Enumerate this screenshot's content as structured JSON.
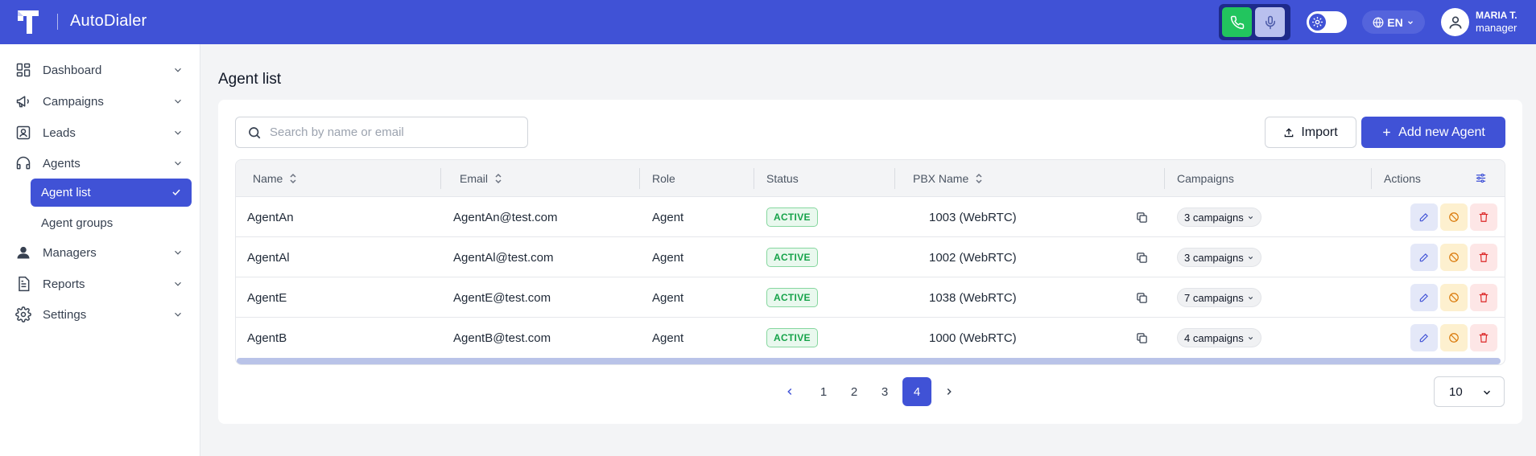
{
  "app": {
    "title": "AutoDialer"
  },
  "header": {
    "lang": "EN",
    "user_name": "MARIA T.",
    "user_role": "manager"
  },
  "sidebar": {
    "items": [
      {
        "label": "Dashboard",
        "icon": "dashboard-icon"
      },
      {
        "label": "Campaigns",
        "icon": "megaphone-icon"
      },
      {
        "label": "Leads",
        "icon": "id-card-icon"
      },
      {
        "label": "Agents",
        "icon": "headset-icon"
      },
      {
        "label": "Managers",
        "icon": "user-icon"
      },
      {
        "label": "Reports",
        "icon": "report-icon"
      },
      {
        "label": "Settings",
        "icon": "gear-icon"
      }
    ],
    "sub_items": [
      {
        "label": "Agent list",
        "active": true
      },
      {
        "label": "Agent groups",
        "active": false
      }
    ]
  },
  "main": {
    "title": "Agent list",
    "search_placeholder": "Search by name or email",
    "import_label": "Import",
    "add_label": "Add new Agent",
    "columns": [
      "Name",
      "Email",
      "Role",
      "Status",
      "PBX Name",
      "Campaigns",
      "Actions"
    ],
    "rows": [
      {
        "name": "AgentAn",
        "email": "AgentAn@test.com",
        "role": "Agent",
        "status": "ACTIVE",
        "pbx": "1003 (WebRTC)",
        "campaigns": "3 campaigns"
      },
      {
        "name": "AgentAl",
        "email": "AgentAl@test.com",
        "role": "Agent",
        "status": "ACTIVE",
        "pbx": "1002 (WebRTC)",
        "campaigns": "3 campaigns"
      },
      {
        "name": "AgentE",
        "email": "AgentE@test.com",
        "role": "Agent",
        "status": "ACTIVE",
        "pbx": "1038 (WebRTC)",
        "campaigns": "7 campaigns"
      },
      {
        "name": "AgentB",
        "email": "AgentB@test.com",
        "role": "Agent",
        "status": "ACTIVE",
        "pbx": "1000 (WebRTC)",
        "campaigns": "4 campaigns"
      }
    ],
    "pagination": {
      "pages": [
        "1",
        "2",
        "3",
        "4"
      ],
      "current": "4",
      "per_page": "10"
    }
  },
  "colors": {
    "brand": "#4052d6",
    "active_status": "#16a34a",
    "call_green": "#22c55e"
  }
}
